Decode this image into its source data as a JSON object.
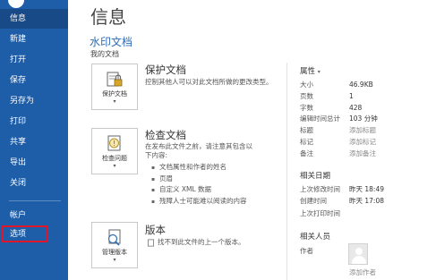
{
  "sidebar": {
    "items": [
      {
        "label": "信息"
      },
      {
        "label": "新建"
      },
      {
        "label": "打开"
      },
      {
        "label": "保存"
      },
      {
        "label": "另存为"
      },
      {
        "label": "打印"
      },
      {
        "label": "共享"
      },
      {
        "label": "导出"
      },
      {
        "label": "关闭"
      },
      {
        "label": "帐户"
      },
      {
        "label": "选项"
      }
    ],
    "active_item": "信息",
    "highlight_color": "#e0162b"
  },
  "main": {
    "title": "信息",
    "doc_title": "水印文档",
    "doc_path": "我的文档",
    "sections": {
      "protect": {
        "button_label": "保护文档",
        "title": "保护文档",
        "description": "控制其他人可以对此文档所做的更改类型。"
      },
      "inspect": {
        "button_label": "检查问题",
        "title": "检查文档",
        "description_line1": "在发布此文件之前，请注意其包含以",
        "description_line2": "下内容:",
        "bullets": [
          "文档属性和作者的姓名",
          "页眉",
          "自定义 XML 数据",
          "残障人士可能难以阅读的内容"
        ]
      },
      "versions": {
        "button_label": "管理版本",
        "title": "版本",
        "description": "找不到此文件的上一个版本。"
      }
    }
  },
  "properties": {
    "heading": "属性",
    "rows": [
      {
        "key": "大小",
        "value": "46.9KB"
      },
      {
        "key": "页数",
        "value": "1"
      },
      {
        "key": "字数",
        "value": "428"
      },
      {
        "key": "编辑时间总计",
        "value": "103 分钟"
      },
      {
        "key": "标题",
        "value": "添加标题"
      },
      {
        "key": "标记",
        "value": "添加标记"
      },
      {
        "key": "备注",
        "value": "添加备注"
      }
    ]
  },
  "dates": {
    "heading": "相关日期",
    "rows": [
      {
        "key": "上次修改时间",
        "value": "昨天 18:49"
      },
      {
        "key": "创建时间",
        "value": "昨天 17:08"
      },
      {
        "key": "上次打印时间",
        "value": ""
      }
    ]
  },
  "people": {
    "heading": "相关人员",
    "author_label": "作者",
    "add_author": "添加作者"
  },
  "colors": {
    "sidebar": "#1e5da8",
    "accent": "#2e6db4"
  }
}
